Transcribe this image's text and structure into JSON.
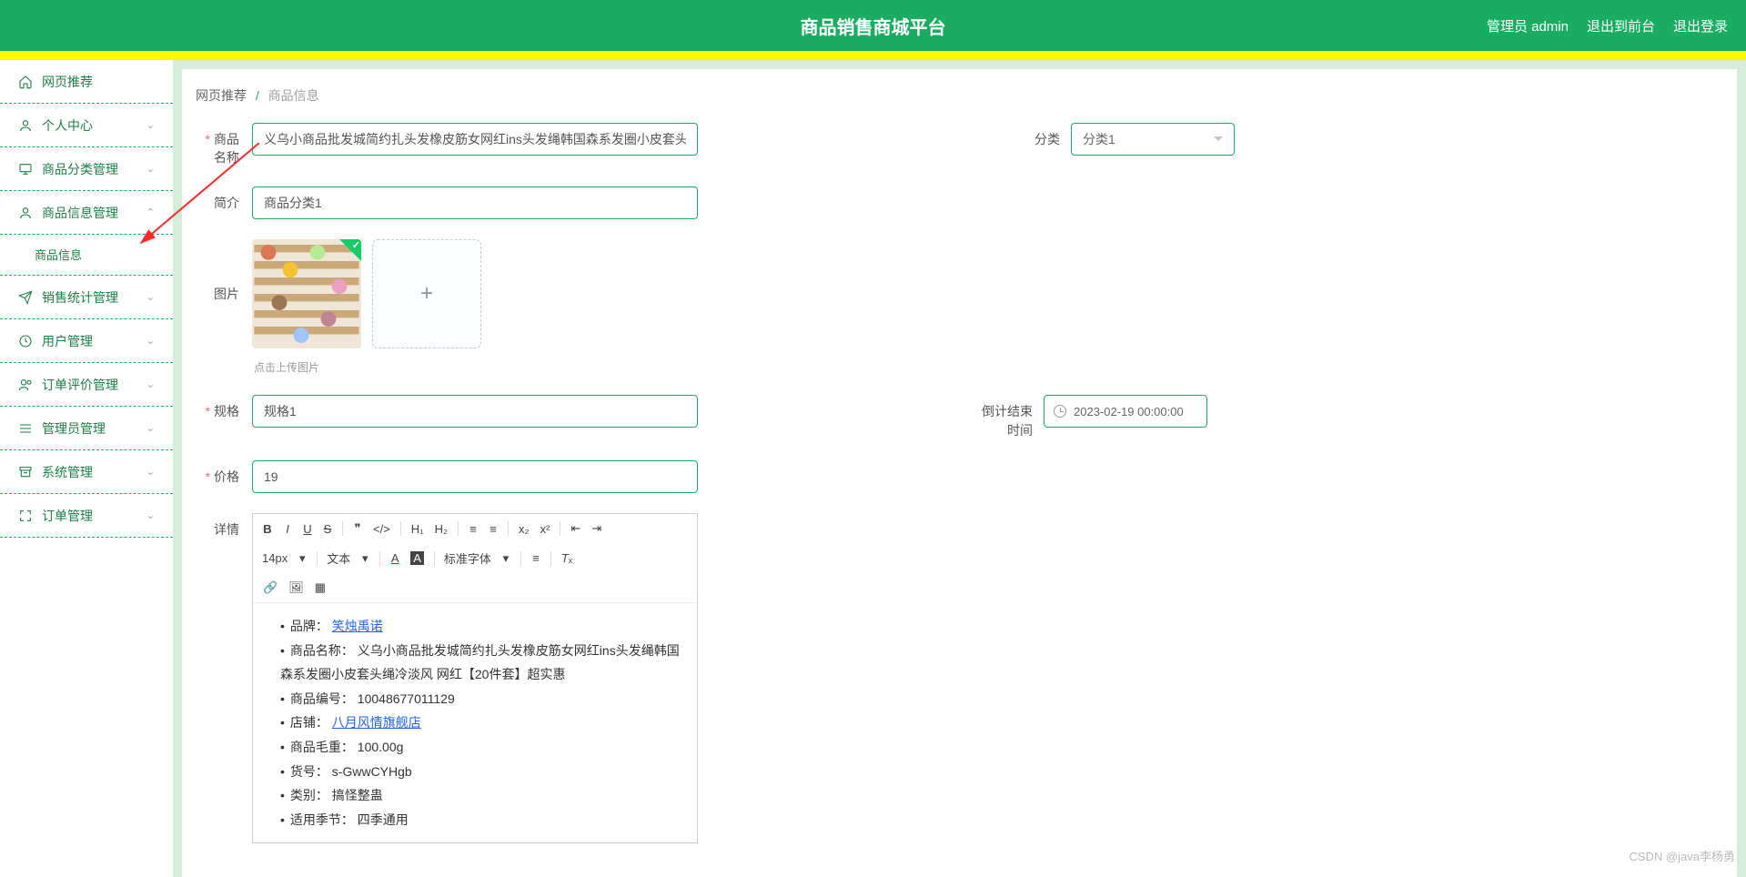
{
  "header": {
    "title": "商品销售商城平台",
    "actions": {
      "admin": "管理员 admin",
      "to_front": "退出到前台",
      "logout": "退出登录"
    }
  },
  "sidebar": {
    "items": [
      {
        "id": "home",
        "label": "网页推荐",
        "hasChevron": false
      },
      {
        "id": "profile",
        "label": "个人中心"
      },
      {
        "id": "category",
        "label": "商品分类管理"
      },
      {
        "id": "product-info",
        "label": "商品信息管理",
        "expanded": true
      },
      {
        "id": "sales-stats",
        "label": "销售统计管理"
      },
      {
        "id": "user-mgmt",
        "label": "用户管理"
      },
      {
        "id": "review",
        "label": "订单评价管理"
      },
      {
        "id": "admin-mgmt",
        "label": "管理员管理"
      },
      {
        "id": "system",
        "label": "系统管理"
      },
      {
        "id": "order-mgmt",
        "label": "订单管理"
      }
    ],
    "submenu": {
      "product_info": "商品信息"
    }
  },
  "breadcrumb": {
    "root": "网页推荐",
    "current": "商品信息"
  },
  "form": {
    "name_label": "商品名称",
    "name_value": "义乌小商品批发城简约扎头发橡皮筋女网红ins头发绳韩国森系发圈小皮套头绳冷淡风",
    "category_label": "分类",
    "category_value": "分类1",
    "brief_label": "简介",
    "brief_value": "商品分类1",
    "image_label": "图片",
    "upload_hint": "点击上传图片",
    "spec_label": "规格",
    "spec_value": "规格1",
    "countdown_label": "倒计结束时间",
    "countdown_value": "2023-02-19 00:00:00",
    "price_label": "价格",
    "price_value": "19",
    "detail_label": "详情"
  },
  "editor": {
    "font_size": "14px",
    "text_label": "文本",
    "font_label": "标准字体",
    "details": {
      "brand_label": "品牌：",
      "brand_link": "笑烛禹诺",
      "name_label": "商品名称：",
      "name_value": "义乌小商品批发城简约扎头发橡皮筋女网红ins头发绳韩国森系发圈小皮套头绳冷淡风 网红【20件套】超实惠",
      "code_label": "商品编号：",
      "code_value": "10048677011129",
      "shop_label": "店铺：",
      "shop_link": "八月风情旗舰店",
      "weight_label": "商品毛重：",
      "weight_value": "100.00g",
      "sku_label": "货号：",
      "sku_value": "s-GwwCYHgb",
      "type_label": "类别：",
      "type_value": "搞怪整蛊",
      "season_label": "适用季节：",
      "season_value": "四季通用"
    }
  },
  "watermark": "CSDN @java李杨勇"
}
